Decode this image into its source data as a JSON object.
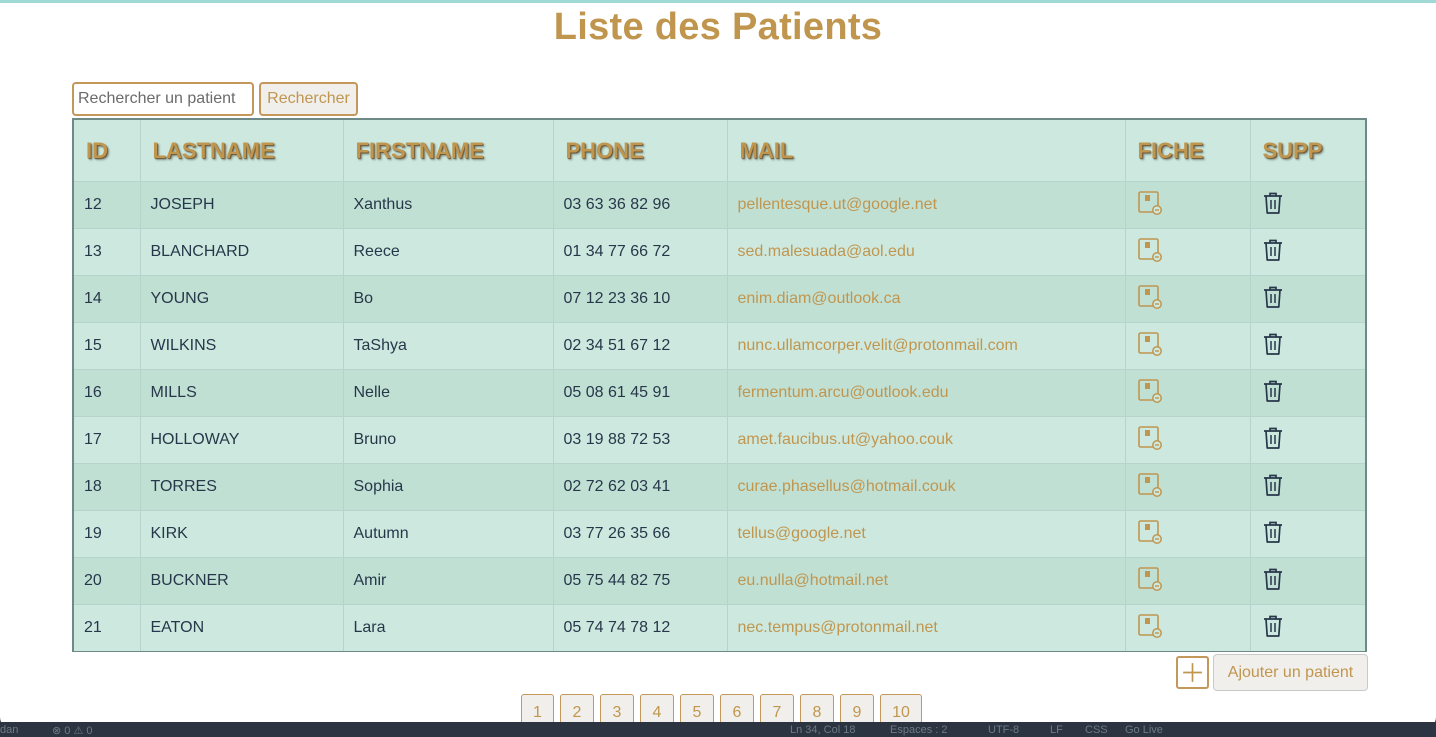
{
  "page_title": "Liste des Patients",
  "search": {
    "placeholder": "Rechercher un patient",
    "value": "",
    "button_label": "Rechercher"
  },
  "table": {
    "headers": [
      "ID",
      "LASTNAME",
      "FIRSTNAME",
      "PHONE",
      "MAIL",
      "FICHE",
      "SUPP"
    ],
    "rows": [
      {
        "id": "12",
        "lastname": "JOSEPH",
        "firstname": "Xanthus",
        "phone": "03 63 36 82 96",
        "mail": "pellentesque.ut@google.net"
      },
      {
        "id": "13",
        "lastname": "BLANCHARD",
        "firstname": "Reece",
        "phone": "01 34 77 66 72",
        "mail": "sed.malesuada@aol.edu"
      },
      {
        "id": "14",
        "lastname": "YOUNG",
        "firstname": "Bo",
        "phone": "07 12 23 36 10",
        "mail": "enim.diam@outlook.ca"
      },
      {
        "id": "15",
        "lastname": "WILKINS",
        "firstname": "TaShya",
        "phone": "02 34 51 67 12",
        "mail": "nunc.ullamcorper.velit@protonmail.com"
      },
      {
        "id": "16",
        "lastname": "MILLS",
        "firstname": "Nelle",
        "phone": "05 08 61 45 91",
        "mail": "fermentum.arcu@outlook.edu"
      },
      {
        "id": "17",
        "lastname": "HOLLOWAY",
        "firstname": "Bruno",
        "phone": "03 19 88 72 53",
        "mail": "amet.faucibus.ut@yahoo.couk"
      },
      {
        "id": "18",
        "lastname": "TORRES",
        "firstname": "Sophia",
        "phone": "02 72 62 03 41",
        "mail": "curae.phasellus@hotmail.couk"
      },
      {
        "id": "19",
        "lastname": "KIRK",
        "firstname": "Autumn",
        "phone": "03 77 26 35 66",
        "mail": "tellus@google.net"
      },
      {
        "id": "20",
        "lastname": "BUCKNER",
        "firstname": "Amir",
        "phone": "05 75 44 82 75",
        "mail": "eu.nulla@hotmail.net"
      },
      {
        "id": "21",
        "lastname": "EATON",
        "firstname": "Lara",
        "phone": "05 74 74 78 12",
        "mail": "nec.tempus@protonmail.net"
      }
    ],
    "fiche_icon": "patient-file-icon",
    "supp_icon": "trash-icon"
  },
  "add_patient": {
    "icon": "plus-icon",
    "label": "Ajouter un patient"
  },
  "pagination": {
    "pages": [
      "1",
      "2",
      "3",
      "4",
      "5",
      "6",
      "7",
      "8",
      "9",
      "10"
    ]
  },
  "colors": {
    "accent": "#c0964f",
    "table_bg": "#cde9df",
    "table_bg_alt": "#c1e0d4",
    "text": "#27374a"
  }
}
